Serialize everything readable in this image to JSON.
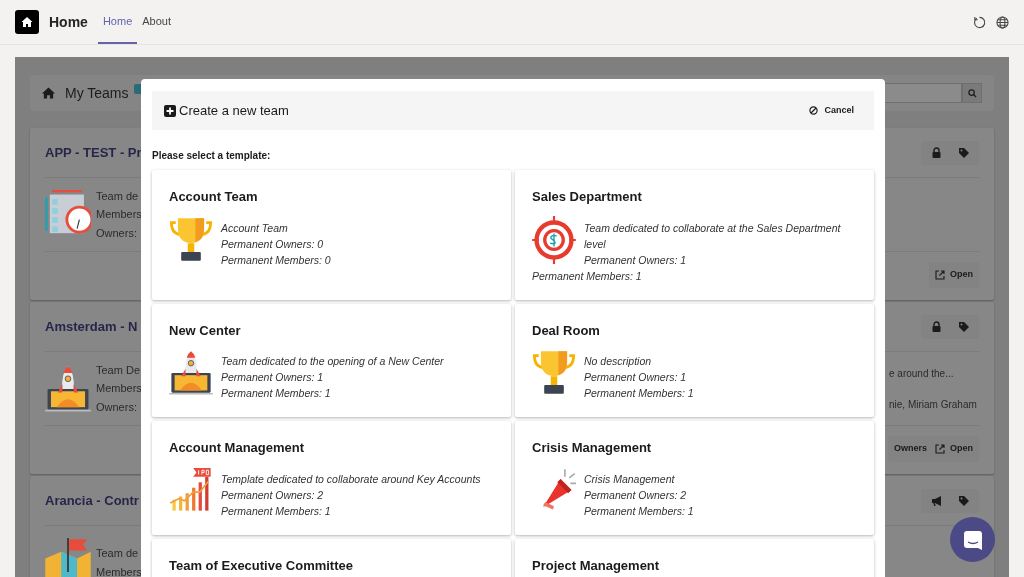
{
  "app_bar": {
    "title": "Home",
    "tabs": [
      {
        "label": "Home",
        "selected": true
      },
      {
        "label": "About",
        "selected": false
      }
    ]
  },
  "background": {
    "header": {
      "title": "My Teams"
    },
    "teams": [
      {
        "title": "APP - TEST - Pr",
        "lines": [
          "Team de",
          "Members",
          "Owners:"
        ],
        "actions": [
          "Open"
        ]
      },
      {
        "title": "Amsterdam - N",
        "lines": [
          "Team De",
          "Members",
          "Owners:"
        ],
        "right_lines": [
          "e around the...",
          "nie, Miriam Graham"
        ],
        "actions": [
          "Owners",
          "Open"
        ]
      },
      {
        "title": "Arancia - Contr",
        "lines": [
          "Team de",
          "Members"
        ]
      }
    ]
  },
  "dialog": {
    "title": "Create a new team",
    "cancel": "Cancel",
    "prompt": "Please select a template:",
    "templates": [
      {
        "name": "Account Team",
        "description": "Account Team",
        "owners": "Permanent Owners: 0",
        "members": "Permanent Members: 0"
      },
      {
        "name": "Sales Department",
        "description": "Team dedicated to collaborate at the Sales Department level",
        "owners": "Permanent Owners: 1",
        "members": "Permanent Members: 1"
      },
      {
        "name": "New Center",
        "description": "Team dedicated to the opening of a New Center",
        "owners": "Permanent Owners: 1",
        "members": "Permanent Members: 1"
      },
      {
        "name": "Deal Room",
        "description": "No description",
        "owners": "Permanent Owners: 1",
        "members": "Permanent Members: 1"
      },
      {
        "name": "Account Management",
        "description": "Template dedicated to collaborate around Key Accounts",
        "owners": "Permanent Owners: 2",
        "members": "Permanent Members: 1"
      },
      {
        "name": "Crisis Management",
        "description": "Crisis Management",
        "owners": "Permanent Owners: 2",
        "members": "Permanent Members: 1"
      },
      {
        "name": "Team of Executive Committee"
      },
      {
        "name": "Project Management"
      }
    ]
  }
}
